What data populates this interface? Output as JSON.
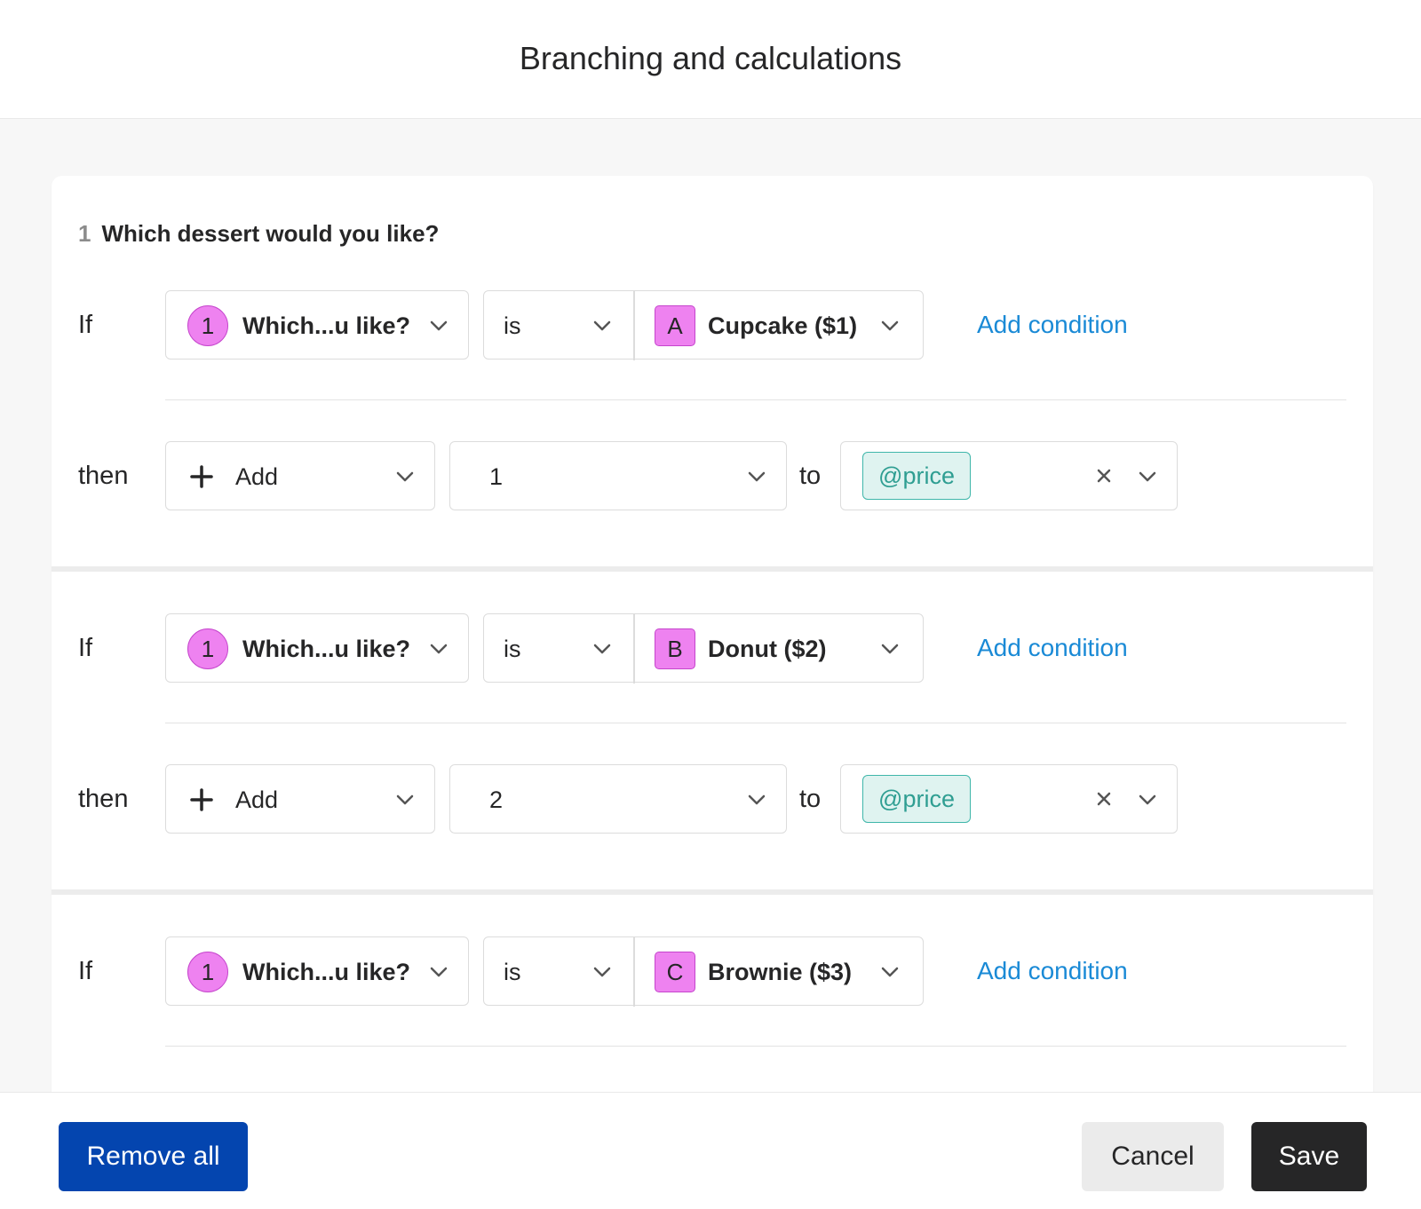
{
  "dialog": {
    "title": "Branching and calculations"
  },
  "question": {
    "number": "1",
    "text": "Which dessert would you like?"
  },
  "rules": [
    {
      "if_label": "If",
      "question_ref": {
        "badge": "1",
        "label": "Which...u like?"
      },
      "operator": "is",
      "answer": {
        "badge": "A",
        "label": "Cupcake ($1)"
      },
      "add_condition": "Add condition",
      "then_label": "then",
      "action": "Add",
      "value": "1",
      "to_label": "to",
      "variable": "@price"
    },
    {
      "if_label": "If",
      "question_ref": {
        "badge": "1",
        "label": "Which...u like?"
      },
      "operator": "is",
      "answer": {
        "badge": "B",
        "label": "Donut ($2)"
      },
      "add_condition": "Add condition",
      "then_label": "then",
      "action": "Add",
      "value": "2",
      "to_label": "to",
      "variable": "@price"
    },
    {
      "if_label": "If",
      "question_ref": {
        "badge": "1",
        "label": "Which...u like?"
      },
      "operator": "is",
      "answer": {
        "badge": "C",
        "label": "Brownie ($3)"
      },
      "add_condition": "Add condition"
    }
  ],
  "footer": {
    "remove_all": "Remove all",
    "cancel": "Cancel",
    "save": "Save"
  },
  "colors": {
    "accent_blue": "#0445af",
    "link": "#1a8ad6",
    "badge_pink": "#ee82f0",
    "chip_teal": "#3fb6aa",
    "save_dark": "#262627"
  }
}
